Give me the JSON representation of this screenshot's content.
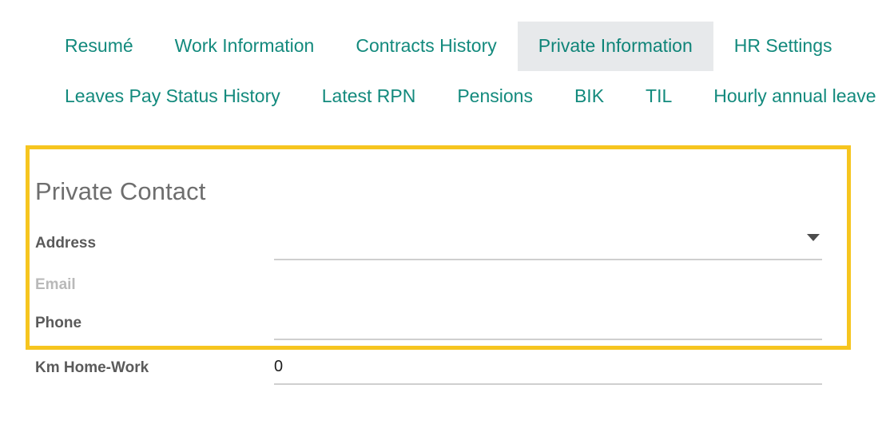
{
  "notebook": {
    "rows": [
      {
        "tabs": [
          {
            "label": "Resumé",
            "active": false
          },
          {
            "label": "Work Information",
            "active": false
          },
          {
            "label": "Contracts History",
            "active": false
          },
          {
            "label": "Private Information",
            "active": true
          },
          {
            "label": "HR Settings",
            "active": false
          }
        ]
      },
      {
        "tabs": [
          {
            "label": "Leaves Pay Status History",
            "active": false
          },
          {
            "label": "Latest RPN",
            "active": false
          },
          {
            "label": "Pensions",
            "active": false
          },
          {
            "label": "BIK",
            "active": false
          },
          {
            "label": "TIL",
            "active": false
          },
          {
            "label": "Hourly annual leave",
            "active": false
          }
        ]
      }
    ]
  },
  "private_contact": {
    "group_title": "Private Contact",
    "fields": {
      "address": {
        "label": "Address",
        "value": "",
        "placeholder": "",
        "dropdown_icon": "chevron-down-icon"
      },
      "email": {
        "label": "Email",
        "value": "",
        "placeholder": ""
      },
      "phone": {
        "label": "Phone",
        "value": "",
        "placeholder": ""
      }
    }
  },
  "other_fields": {
    "km_home_work": {
      "label": "Km Home-Work",
      "value": "0"
    }
  },
  "colors": {
    "tab_text": "#138a7d",
    "active_tab_bg": "#e7e9eb",
    "highlight_border": "#f6c51f",
    "label_text": "#5a5a5a",
    "muted_label_text": "#b9b9b9",
    "group_title_text": "#6e6e6e",
    "field_rule": "#cfcfcf"
  }
}
